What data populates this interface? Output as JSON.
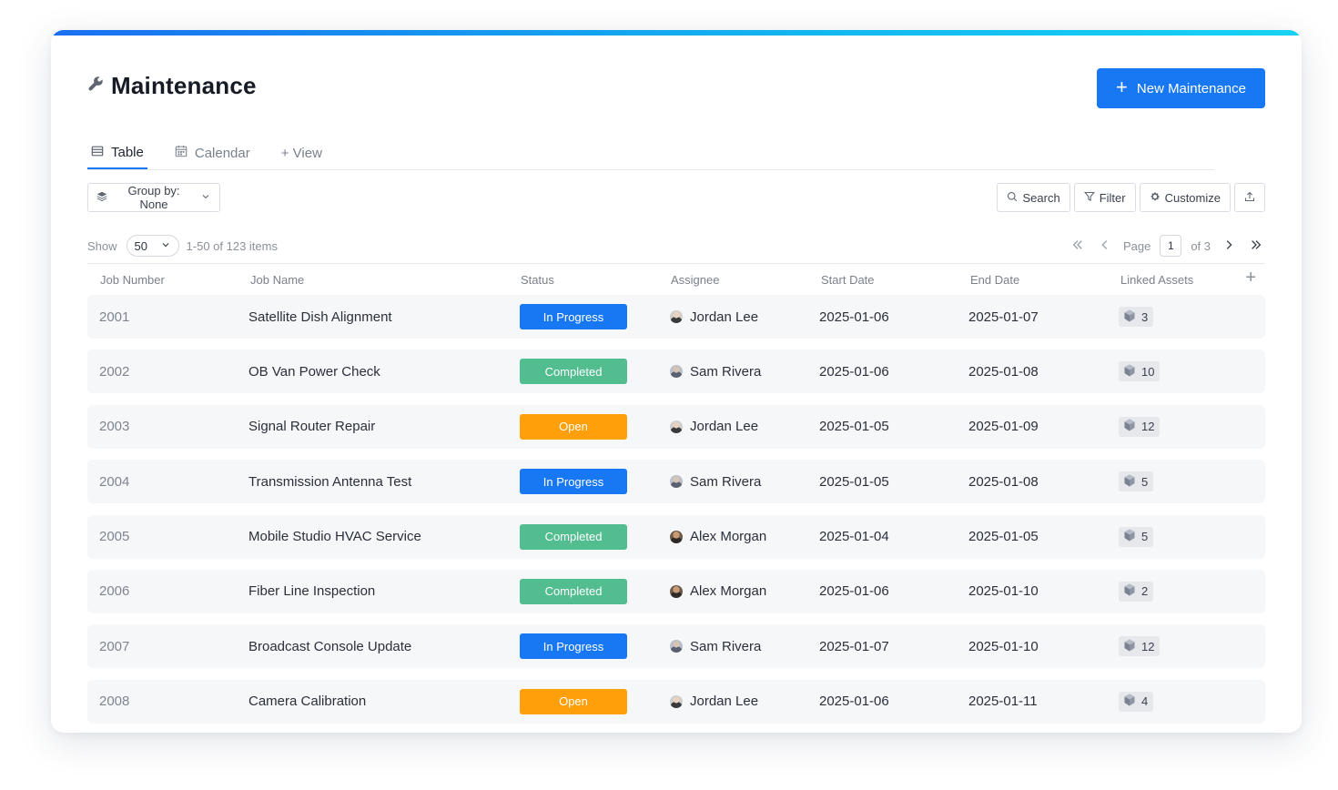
{
  "header": {
    "title": "Maintenance",
    "new_button_label": "New Maintenance"
  },
  "tabs": [
    {
      "label": "Table",
      "active": true
    },
    {
      "label": "Calendar",
      "active": false
    },
    {
      "label": "+ View",
      "active": false
    }
  ],
  "toolbar": {
    "group_by_label": "Group by: None",
    "search_label": "Search",
    "filter_label": "Filter",
    "customize_label": "Customize"
  },
  "pagination": {
    "show_label": "Show",
    "page_size": "50",
    "range_text": "1-50 of 123 items",
    "page_label": "Page",
    "current_page": "1",
    "total_pages_text": "of 3"
  },
  "columns": [
    "Job Number",
    "Job Name",
    "Status",
    "Assignee",
    "Start Date",
    "End Date",
    "Linked Assets"
  ],
  "status_colors": {
    "In Progress": "#1877f2",
    "Completed": "#52bd8f",
    "Open": "#ff9f0a"
  },
  "rows": [
    {
      "job_number": "2001",
      "job_name": "Satellite Dish Alignment",
      "status": "In Progress",
      "assignee": "Jordan Lee",
      "start_date": "2025-01-06",
      "end_date": "2025-01-07",
      "linked_assets": "3"
    },
    {
      "job_number": "2002",
      "job_name": "OB Van Power Check",
      "status": "Completed",
      "assignee": "Sam Rivera",
      "start_date": "2025-01-06",
      "end_date": "2025-01-08",
      "linked_assets": "10"
    },
    {
      "job_number": "2003",
      "job_name": "Signal Router Repair",
      "status": "Open",
      "assignee": "Jordan Lee",
      "start_date": "2025-01-05",
      "end_date": "2025-01-09",
      "linked_assets": "12"
    },
    {
      "job_number": "2004",
      "job_name": "Transmission Antenna Test",
      "status": "In Progress",
      "assignee": "Sam Rivera",
      "start_date": "2025-01-05",
      "end_date": "2025-01-08",
      "linked_assets": "5"
    },
    {
      "job_number": "2005",
      "job_name": "Mobile Studio HVAC Service",
      "status": "Completed",
      "assignee": "Alex Morgan",
      "start_date": "2025-01-04",
      "end_date": "2025-01-05",
      "linked_assets": "5"
    },
    {
      "job_number": "2006",
      "job_name": "Fiber Line Inspection",
      "status": "Completed",
      "assignee": "Alex Morgan",
      "start_date": "2025-01-06",
      "end_date": "2025-01-10",
      "linked_assets": "2"
    },
    {
      "job_number": "2007",
      "job_name": "Broadcast Console Update",
      "status": "In Progress",
      "assignee": "Sam Rivera",
      "start_date": "2025-01-07",
      "end_date": "2025-01-10",
      "linked_assets": "12"
    },
    {
      "job_number": "2008",
      "job_name": "Camera Calibration",
      "status": "Open",
      "assignee": "Jordan Lee",
      "start_date": "2025-01-06",
      "end_date": "2025-01-11",
      "linked_assets": "4"
    }
  ]
}
